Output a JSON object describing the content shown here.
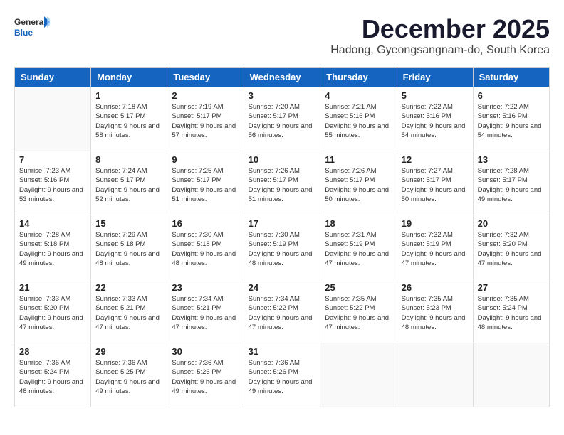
{
  "header": {
    "logo_general": "General",
    "logo_blue": "Blue",
    "month_title": "December 2025",
    "subtitle": "Hadong, Gyeongsangnam-do, South Korea"
  },
  "weekdays": [
    "Sunday",
    "Monday",
    "Tuesday",
    "Wednesday",
    "Thursday",
    "Friday",
    "Saturday"
  ],
  "weeks": [
    [
      null,
      {
        "day": "1",
        "sunrise": "Sunrise: 7:18 AM",
        "sunset": "Sunset: 5:17 PM",
        "daylight": "Daylight: 9 hours and 58 minutes."
      },
      {
        "day": "2",
        "sunrise": "Sunrise: 7:19 AM",
        "sunset": "Sunset: 5:17 PM",
        "daylight": "Daylight: 9 hours and 57 minutes."
      },
      {
        "day": "3",
        "sunrise": "Sunrise: 7:20 AM",
        "sunset": "Sunset: 5:17 PM",
        "daylight": "Daylight: 9 hours and 56 minutes."
      },
      {
        "day": "4",
        "sunrise": "Sunrise: 7:21 AM",
        "sunset": "Sunset: 5:16 PM",
        "daylight": "Daylight: 9 hours and 55 minutes."
      },
      {
        "day": "5",
        "sunrise": "Sunrise: 7:22 AM",
        "sunset": "Sunset: 5:16 PM",
        "daylight": "Daylight: 9 hours and 54 minutes."
      },
      {
        "day": "6",
        "sunrise": "Sunrise: 7:22 AM",
        "sunset": "Sunset: 5:16 PM",
        "daylight": "Daylight: 9 hours and 54 minutes."
      }
    ],
    [
      {
        "day": "7",
        "sunrise": "Sunrise: 7:23 AM",
        "sunset": "Sunset: 5:16 PM",
        "daylight": "Daylight: 9 hours and 53 minutes."
      },
      {
        "day": "8",
        "sunrise": "Sunrise: 7:24 AM",
        "sunset": "Sunset: 5:17 PM",
        "daylight": "Daylight: 9 hours and 52 minutes."
      },
      {
        "day": "9",
        "sunrise": "Sunrise: 7:25 AM",
        "sunset": "Sunset: 5:17 PM",
        "daylight": "Daylight: 9 hours and 51 minutes."
      },
      {
        "day": "10",
        "sunrise": "Sunrise: 7:26 AM",
        "sunset": "Sunset: 5:17 PM",
        "daylight": "Daylight: 9 hours and 51 minutes."
      },
      {
        "day": "11",
        "sunrise": "Sunrise: 7:26 AM",
        "sunset": "Sunset: 5:17 PM",
        "daylight": "Daylight: 9 hours and 50 minutes."
      },
      {
        "day": "12",
        "sunrise": "Sunrise: 7:27 AM",
        "sunset": "Sunset: 5:17 PM",
        "daylight": "Daylight: 9 hours and 50 minutes."
      },
      {
        "day": "13",
        "sunrise": "Sunrise: 7:28 AM",
        "sunset": "Sunset: 5:17 PM",
        "daylight": "Daylight: 9 hours and 49 minutes."
      }
    ],
    [
      {
        "day": "14",
        "sunrise": "Sunrise: 7:28 AM",
        "sunset": "Sunset: 5:18 PM",
        "daylight": "Daylight: 9 hours and 49 minutes."
      },
      {
        "day": "15",
        "sunrise": "Sunrise: 7:29 AM",
        "sunset": "Sunset: 5:18 PM",
        "daylight": "Daylight: 9 hours and 48 minutes."
      },
      {
        "day": "16",
        "sunrise": "Sunrise: 7:30 AM",
        "sunset": "Sunset: 5:18 PM",
        "daylight": "Daylight: 9 hours and 48 minutes."
      },
      {
        "day": "17",
        "sunrise": "Sunrise: 7:30 AM",
        "sunset": "Sunset: 5:19 PM",
        "daylight": "Daylight: 9 hours and 48 minutes."
      },
      {
        "day": "18",
        "sunrise": "Sunrise: 7:31 AM",
        "sunset": "Sunset: 5:19 PM",
        "daylight": "Daylight: 9 hours and 47 minutes."
      },
      {
        "day": "19",
        "sunrise": "Sunrise: 7:32 AM",
        "sunset": "Sunset: 5:19 PM",
        "daylight": "Daylight: 9 hours and 47 minutes."
      },
      {
        "day": "20",
        "sunrise": "Sunrise: 7:32 AM",
        "sunset": "Sunset: 5:20 PM",
        "daylight": "Daylight: 9 hours and 47 minutes."
      }
    ],
    [
      {
        "day": "21",
        "sunrise": "Sunrise: 7:33 AM",
        "sunset": "Sunset: 5:20 PM",
        "daylight": "Daylight: 9 hours and 47 minutes."
      },
      {
        "day": "22",
        "sunrise": "Sunrise: 7:33 AM",
        "sunset": "Sunset: 5:21 PM",
        "daylight": "Daylight: 9 hours and 47 minutes."
      },
      {
        "day": "23",
        "sunrise": "Sunrise: 7:34 AM",
        "sunset": "Sunset: 5:21 PM",
        "daylight": "Daylight: 9 hours and 47 minutes."
      },
      {
        "day": "24",
        "sunrise": "Sunrise: 7:34 AM",
        "sunset": "Sunset: 5:22 PM",
        "daylight": "Daylight: 9 hours and 47 minutes."
      },
      {
        "day": "25",
        "sunrise": "Sunrise: 7:35 AM",
        "sunset": "Sunset: 5:22 PM",
        "daylight": "Daylight: 9 hours and 47 minutes."
      },
      {
        "day": "26",
        "sunrise": "Sunrise: 7:35 AM",
        "sunset": "Sunset: 5:23 PM",
        "daylight": "Daylight: 9 hours and 48 minutes."
      },
      {
        "day": "27",
        "sunrise": "Sunrise: 7:35 AM",
        "sunset": "Sunset: 5:24 PM",
        "daylight": "Daylight: 9 hours and 48 minutes."
      }
    ],
    [
      {
        "day": "28",
        "sunrise": "Sunrise: 7:36 AM",
        "sunset": "Sunset: 5:24 PM",
        "daylight": "Daylight: 9 hours and 48 minutes."
      },
      {
        "day": "29",
        "sunrise": "Sunrise: 7:36 AM",
        "sunset": "Sunset: 5:25 PM",
        "daylight": "Daylight: 9 hours and 49 minutes."
      },
      {
        "day": "30",
        "sunrise": "Sunrise: 7:36 AM",
        "sunset": "Sunset: 5:26 PM",
        "daylight": "Daylight: 9 hours and 49 minutes."
      },
      {
        "day": "31",
        "sunrise": "Sunrise: 7:36 AM",
        "sunset": "Sunset: 5:26 PM",
        "daylight": "Daylight: 9 hours and 49 minutes."
      },
      null,
      null,
      null
    ]
  ]
}
